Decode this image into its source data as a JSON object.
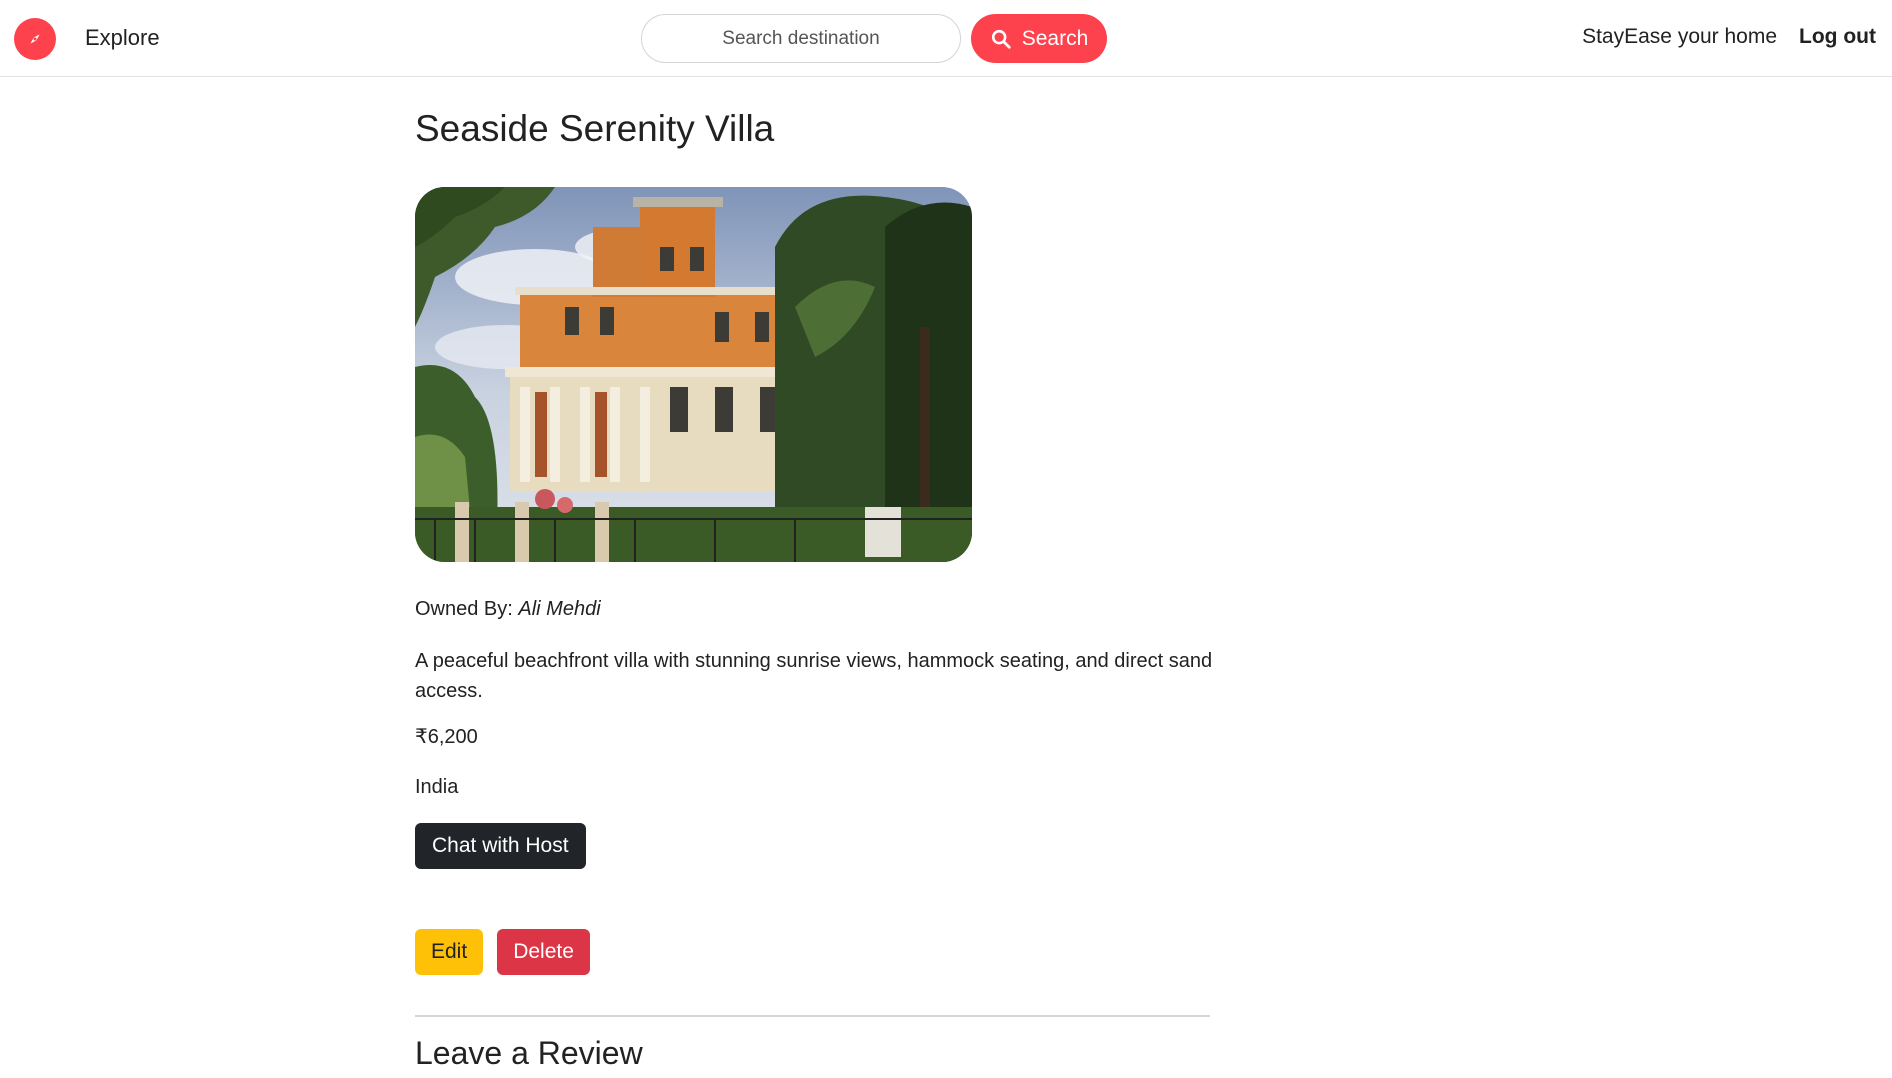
{
  "navbar": {
    "explore_label": "Explore",
    "search_placeholder": "Search destination",
    "search_button_label": "Search",
    "host_label": "StayEase your home",
    "logout_label": "Log out",
    "brand_color": "#fe424d"
  },
  "listing": {
    "title": "Seaside Serenity Villa",
    "owner_prefix": "Owned By:",
    "owner_name": "Ali Mehdi",
    "description": "A peaceful beachfront villa with stunning sunrise views, hammock seating, and direct sand access.",
    "price": "₹6,200",
    "country": "India",
    "chat_button_label": "Chat with Host",
    "edit_button_label": "Edit",
    "delete_button_label": "Delete"
  },
  "review": {
    "heading": "Leave a Review"
  },
  "icons": {
    "logo": "compass-icon",
    "search": "search-icon"
  }
}
